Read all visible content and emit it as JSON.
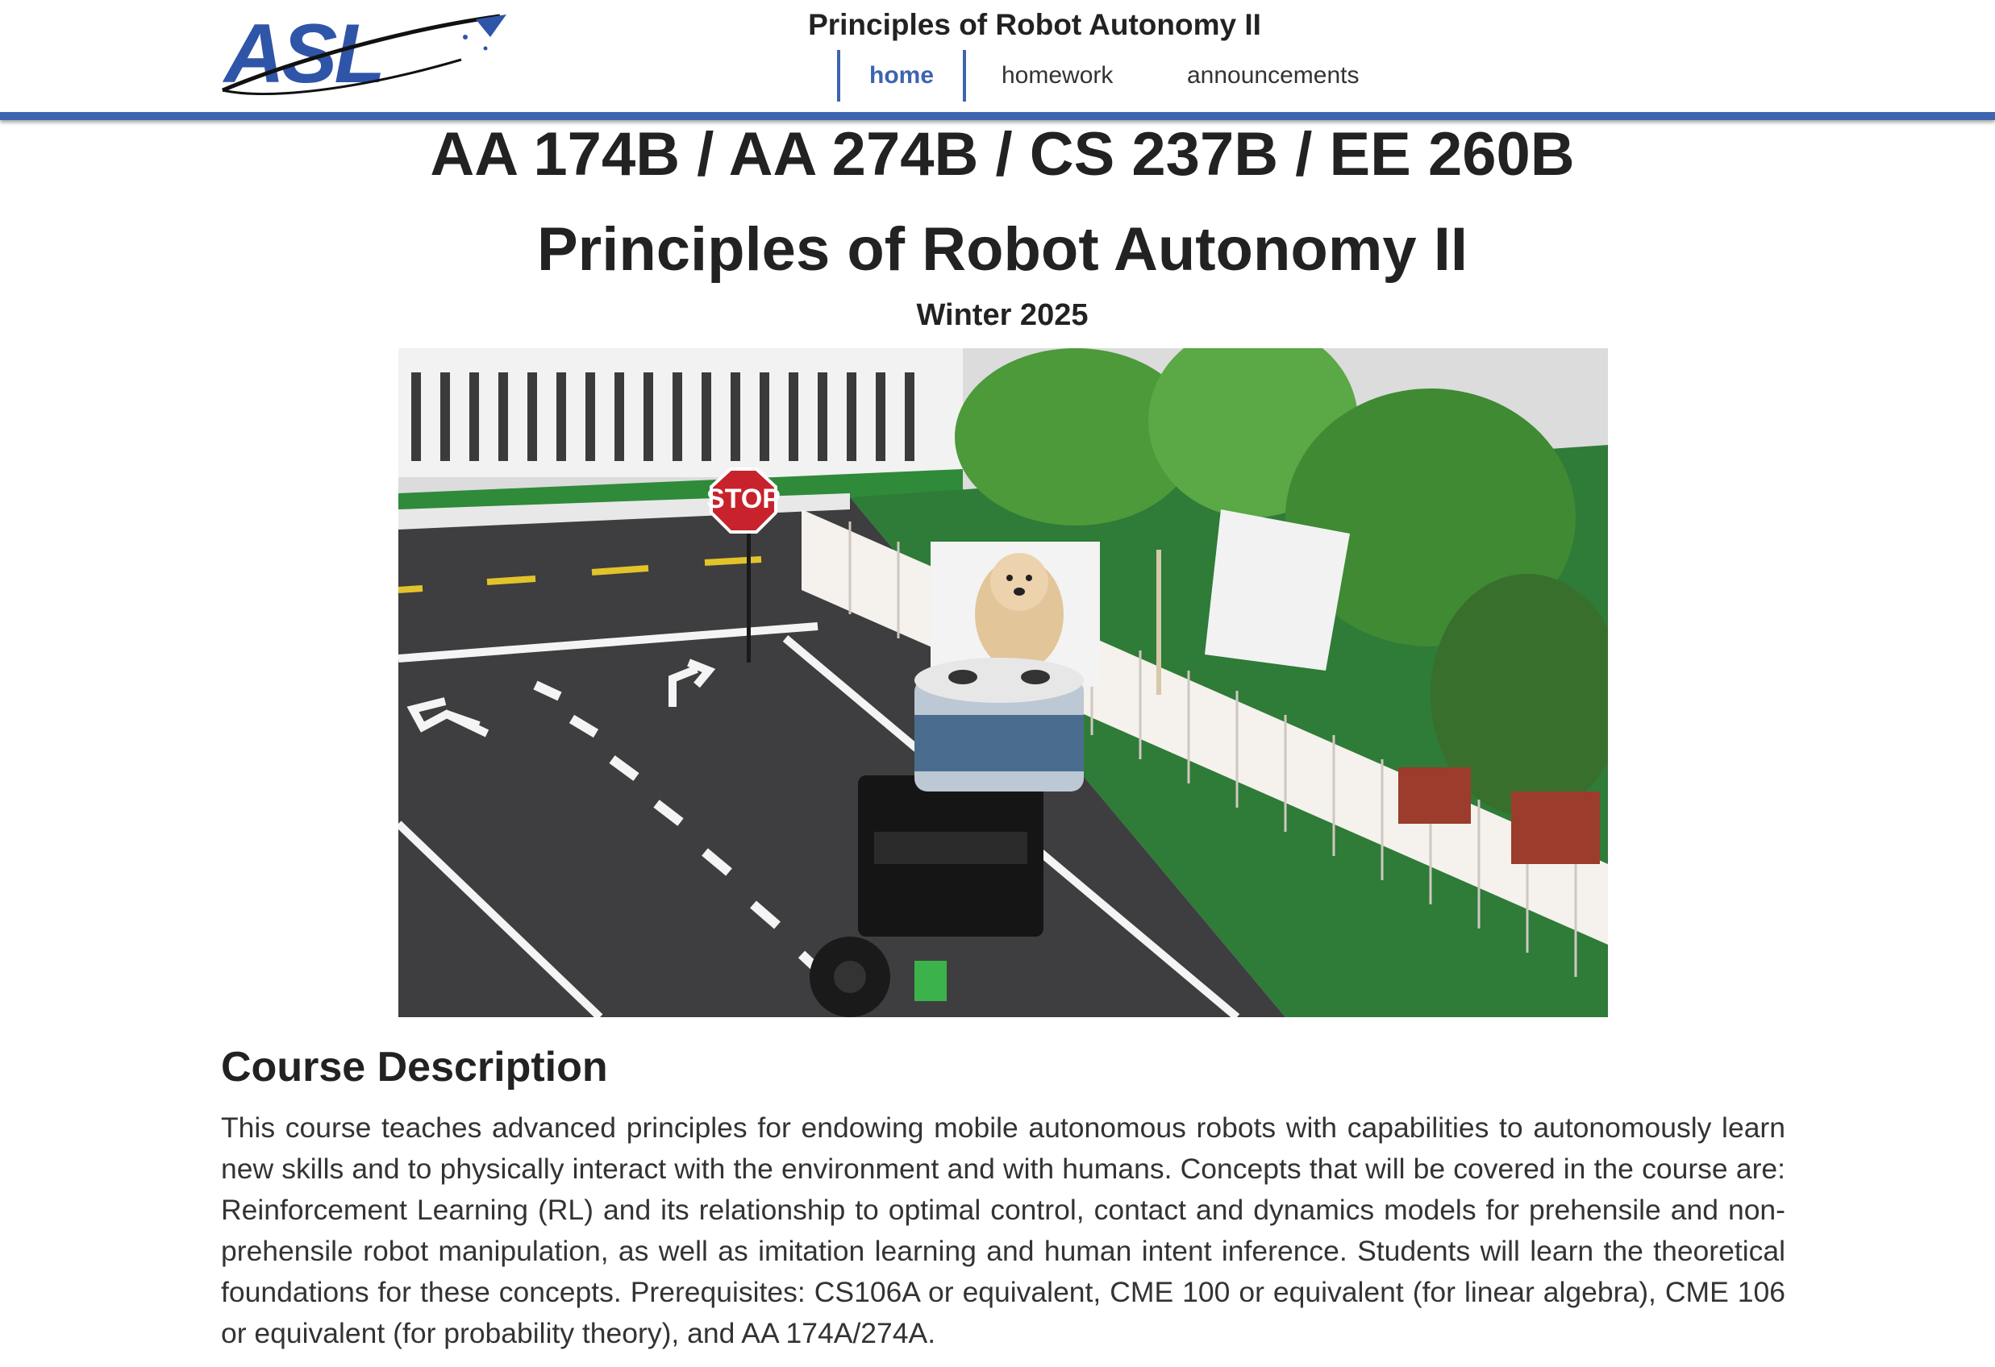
{
  "header": {
    "logo_text": "ASL",
    "site_title": "Principles of Robot Autonomy II",
    "nav": [
      {
        "label": "home",
        "active": true
      },
      {
        "label": "homework",
        "active": false
      },
      {
        "label": "announcements",
        "active": false
      }
    ]
  },
  "main": {
    "course_codes": "AA 174B / AA 274B / CS 237B / EE 260B",
    "course_title": "Principles of Robot Autonomy II",
    "term": "Winter 2025",
    "hero_image": {
      "sign_text": "STOP"
    },
    "section_heading": "Course Description",
    "description": "This course teaches advanced principles for endowing mobile autonomous robots with capabilities to autonomously learn new skills and to physically interact with the environment and with humans. Concepts that will be covered in the course are: Reinforcement Learning (RL) and its relationship to optimal control, contact and dynamics models for prehensile and non-prehensile robot manipulation, as well as imitation learning and human intent inference. Students will learn the theoretical foundations for these concepts. Prerequisites: CS106A or equivalent, CME 100 or equivalent (for linear algebra), CME 106 or equivalent (for probability theory), and AA 174A/274A."
  },
  "colors": {
    "accent": "#3d64b0",
    "text": "#222222"
  }
}
